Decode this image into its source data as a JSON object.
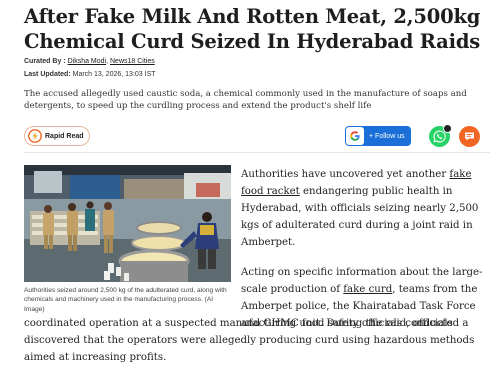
{
  "article": {
    "headline_line1": "After Fake Milk And Rotten Meat, 2,500kg",
    "headline_line2": "Chemical Curd Seized In Hyderabad Raids",
    "curated_label": "Curated By :",
    "author": "Diksha Modi",
    "author_separator": ",",
    "publisher": "News18 Cities",
    "updated_label": "Last Updated:",
    "updated_date": "March 13, 2026, 13:03 IST",
    "summary": "The accused allegedly used caustic soda, a chemical commonly used in the manufacture of soaps and detergents, to speed up the curdling process and extend the product's shelf life"
  },
  "share_bar": {
    "rapid_read_label": "Rapid Read",
    "google_follow_label": "+ Follow us",
    "colors": {
      "google_blue": "#1b6fd8",
      "whatsapp_green": "#25d366",
      "comment_orange": "#f26522"
    }
  },
  "image": {
    "caption": "Authorities seized around 2,500 kg of the adulterated curd, along with chemicals and machinery used in the manufacturing process. (AI Image)"
  },
  "body": {
    "p1_before": "Authorities have uncovered yet another ",
    "p1_link": "fake food racket",
    "p1_after": " endangering public health in Hyderabad, with officials seizing nearly 2,500 kgs of adulterated curd during a joint raid in Amberpet.",
    "p2_before": "Acting on specific information about the large-scale production of ",
    "p2_link": "fake curd",
    "p2_after_side": ", teams from the Amberpet police, the Khairatabad Task Force and GHMC food safety officials conducted a",
    "p2_rest": "coordinated operation at a suspected manufacturing unit. During the raid, officials discovered that the operators were allegedly producing curd using hazardous methods aimed at increasing profits."
  }
}
